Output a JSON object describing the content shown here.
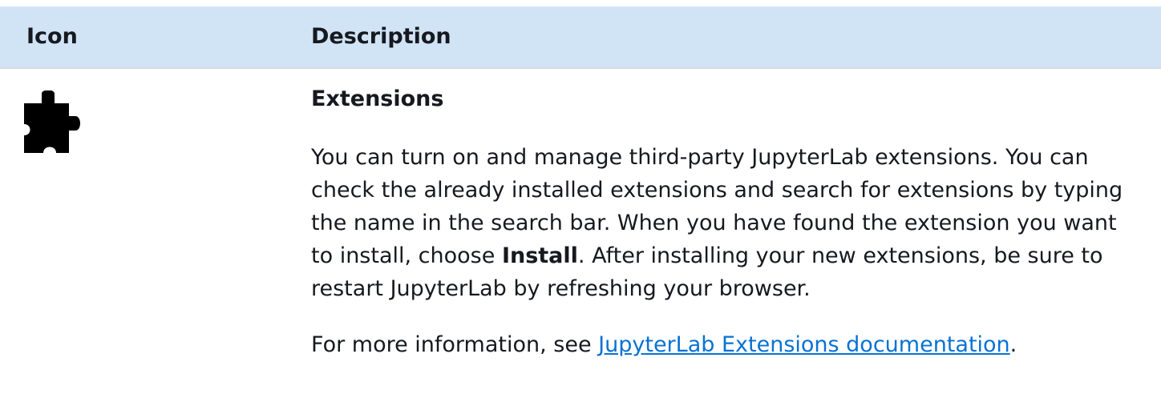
{
  "table": {
    "header": {
      "icon_col": "Icon",
      "description_col": "Description"
    },
    "row": {
      "icon": "puzzle-piece-icon",
      "title": "Extensions",
      "body_part1": "You can turn on and manage third-party JupyterLab extensions. You can check the already installed extensions and search for extensions by typing the name in the search bar. When you have found the extension you want to install, choose ",
      "body_bold": "Install",
      "body_part2": ". After installing your new extensions, be sure to restart JupyterLab by refreshing your browser.",
      "more_prefix": "For more information, see ",
      "more_link": "JupyterLab Extensions documentation",
      "more_suffix": "."
    }
  },
  "colors": {
    "header_bg": "#d1e4f6",
    "link": "#0972d3",
    "text": "#16191f"
  }
}
